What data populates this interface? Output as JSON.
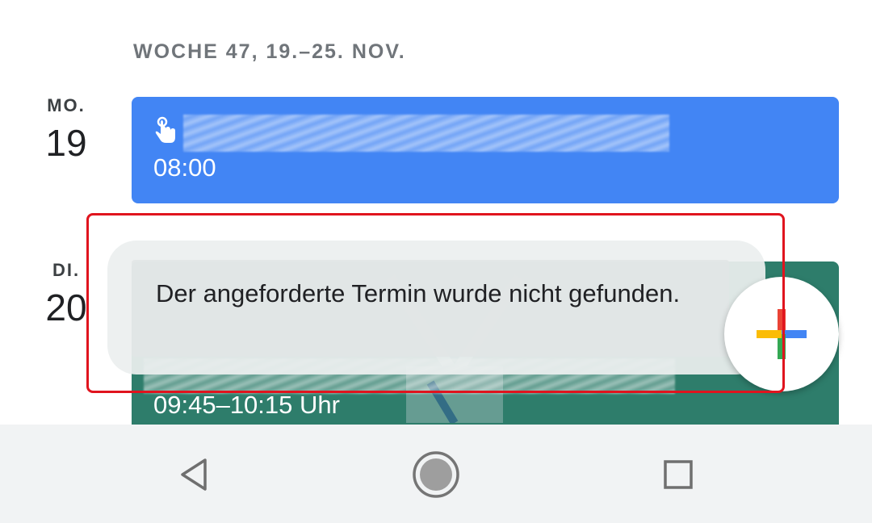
{
  "week_header": "WOCHE 47, 19.–25. NOV.",
  "days": [
    {
      "abbr": "MO.",
      "number": "19",
      "event": {
        "time": "08:00",
        "color": "#4285f4",
        "icon": "touch-icon"
      }
    },
    {
      "abbr": "DI.",
      "number": "20",
      "event": {
        "time": "09:45–10:15 Uhr",
        "color": "#2e7d6b"
      }
    }
  ],
  "snackbar": {
    "message": "Der angeforderte Termin wurde nicht gefunden."
  },
  "fab": {
    "icon": "plus-icon",
    "colors": [
      "#ea4335",
      "#4285f4",
      "#34a853",
      "#fbbc05"
    ]
  },
  "nav_bar": {
    "icons": [
      "back-icon",
      "home-icon",
      "recents-icon"
    ]
  },
  "highlight_color": "#e0141e"
}
